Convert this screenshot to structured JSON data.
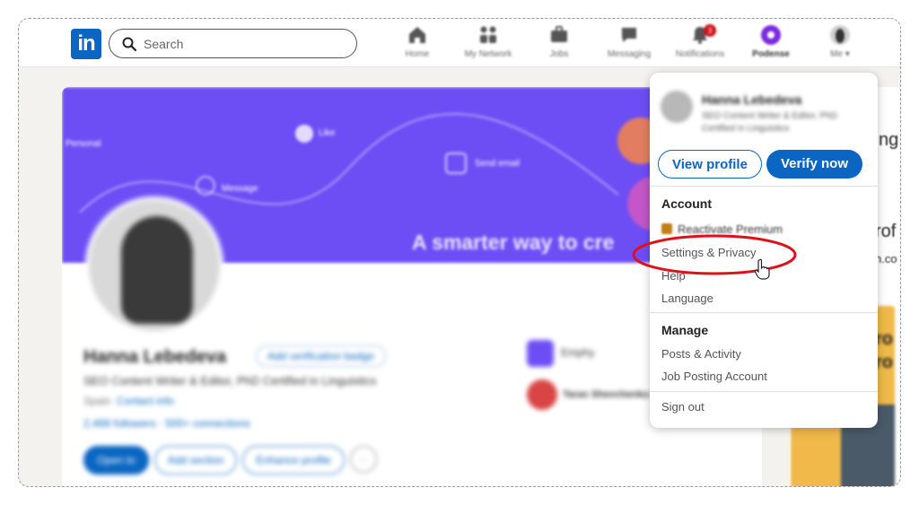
{
  "nav": {
    "logo_text": "in",
    "search_placeholder": "Search",
    "items": [
      {
        "label": "Home",
        "icon": "home-icon"
      },
      {
        "label": "My Network",
        "icon": "network-icon"
      },
      {
        "label": "Jobs",
        "icon": "briefcase-icon"
      },
      {
        "label": "Messaging",
        "icon": "chat-icon"
      },
      {
        "label": "Notifications",
        "icon": "bell-icon",
        "badge": "3"
      },
      {
        "label": "Podense",
        "icon": "podense-icon"
      },
      {
        "label": "Me ▾",
        "icon": "avatar-icon"
      }
    ]
  },
  "profile": {
    "name": "Hanna Lebedeva",
    "verify_badge": "Add verification badge",
    "headline": "SEO Content Writer & Editor, PhD Certified in Linguistics",
    "location": "Spain",
    "contact_info": "Contact info",
    "connections": "2,468 followers · 500+ connections",
    "buttons": [
      "Open to",
      "Add section",
      "Enhance profile",
      "···"
    ],
    "company": "Emphy",
    "school": "Taras Shevchenko University of Kyiv",
    "banner_tagline": "A smarter way to cre",
    "banner_chips": [
      "Personal",
      "Message",
      "Like",
      "Send email"
    ]
  },
  "right_col": {
    "texts": [
      "ng",
      "rof",
      "n.co",
      "ro",
      "ro"
    ]
  },
  "menu": {
    "user_name": "Hanna Lebedeva",
    "user_title": "SEO Content Writer & Editor, PhD Certified in Linguistics",
    "view_profile": "View profile",
    "verify_now": "Verify now",
    "account_title": "Account",
    "account_items": [
      "Reactivate Premium",
      "Settings & Privacy",
      "Help",
      "Language"
    ],
    "manage_title": "Manage",
    "manage_items": [
      "Posts & Activity",
      "Job Posting Account"
    ],
    "sign_out": "Sign out"
  },
  "colors": {
    "brand": "#0a66c2",
    "highlight": "#e0101a",
    "banner": "#6d4ef5"
  }
}
